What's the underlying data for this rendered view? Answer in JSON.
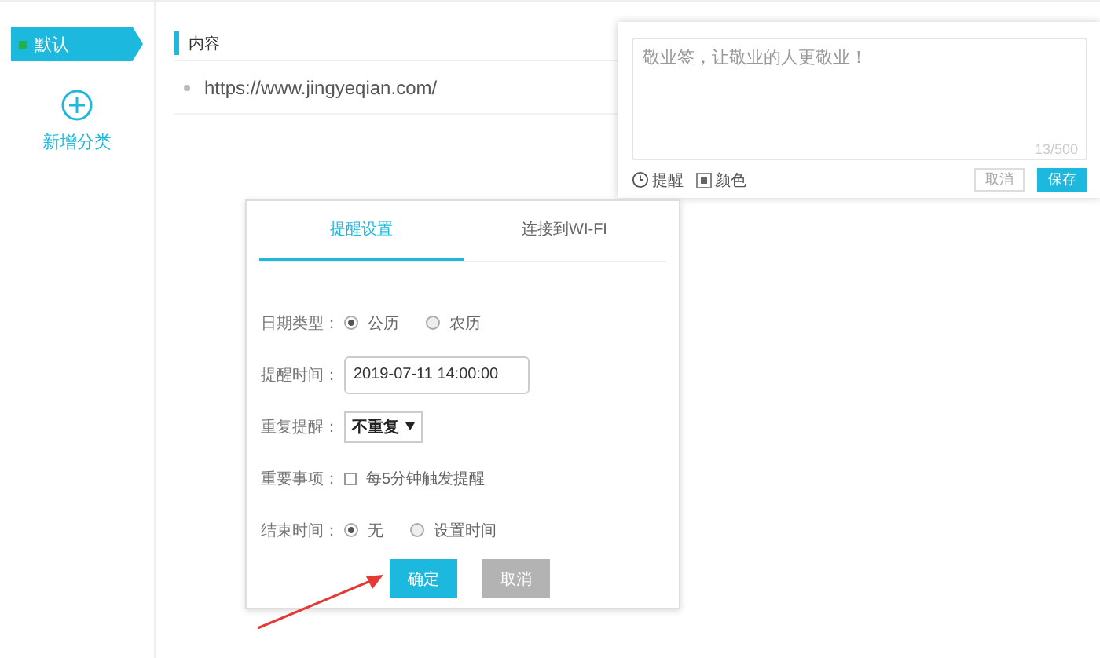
{
  "sidebar": {
    "categories": [
      {
        "label": "默认",
        "selected": true
      }
    ],
    "add_label": "新增分类"
  },
  "content": {
    "header": "内容",
    "items": [
      "https://www.jingyeqian.com/"
    ]
  },
  "note_editor": {
    "placeholder": "敬业签，让敬业的人更敬业！",
    "counter": "13/500",
    "tools": [
      {
        "kind": "reminder",
        "label": "提醒"
      },
      {
        "kind": "color",
        "label": "颜色"
      }
    ],
    "buttons": [
      {
        "kind": "secondary",
        "label": "取消"
      },
      {
        "kind": "primary",
        "label": "保存"
      }
    ]
  },
  "reminder_dialog": {
    "tabs": [
      {
        "label": "提醒设置",
        "selected": true
      },
      {
        "label": "连接到WI-FI",
        "selected": false
      }
    ],
    "rows": [
      {
        "kind": "radio",
        "label": "日期类型：",
        "options": [
          {
            "label": "公历",
            "selected": true
          },
          {
            "label": "农历",
            "selected": false
          }
        ]
      },
      {
        "kind": "input",
        "label": "提醒时间：",
        "value": "2019-07-11 14:00:00"
      },
      {
        "kind": "select",
        "label": "重复提醒：",
        "value": "不重复"
      },
      {
        "kind": "checkbox",
        "label": "重要事项：",
        "option": "每5分钟触发提醒",
        "checked": false
      },
      {
        "kind": "radio",
        "label": "结束时间：",
        "options": [
          {
            "label": "无",
            "selected": true
          },
          {
            "label": "设置时间",
            "selected": false
          }
        ]
      }
    ],
    "buttons": [
      {
        "kind": "primary",
        "label": "确定"
      },
      {
        "kind": "disabled",
        "label": "取消"
      }
    ]
  }
}
